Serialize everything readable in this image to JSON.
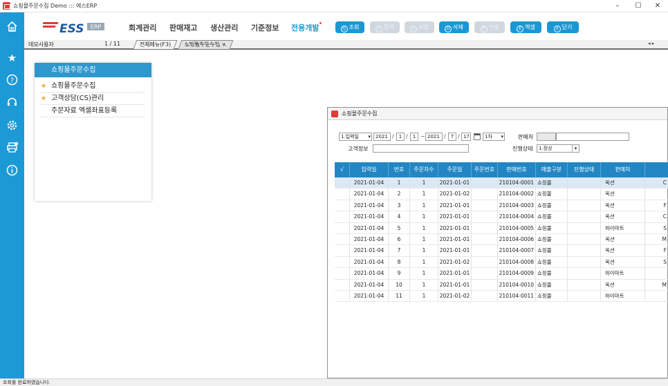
{
  "window": {
    "title": "쇼핑몰주문수집 Demo ::: 에스ERP",
    "minimize": "–",
    "maximize": "☐",
    "close": "✕"
  },
  "rail_icons": [
    "home-icon",
    "star-icon",
    "help-icon",
    "headset-icon",
    "gear-icon",
    "printer-icon",
    "info-icon"
  ],
  "brand": {
    "logo_text": "ESS",
    "logo_badge": "ERP",
    "accent": "#1c9ad6",
    "logo_red": "#e33b36",
    "logo_blue": "#1d5a9e"
  },
  "menu": [
    "회계관리",
    "판매재고",
    "생산관리",
    "기준정보",
    "전용개발"
  ],
  "toolbar": [
    {
      "key": "Q",
      "label": "조회",
      "enabled": true
    },
    {
      "key": "I",
      "label": "입력",
      "enabled": false
    },
    {
      "key": "S",
      "label": "저장",
      "enabled": false
    },
    {
      "key": "D",
      "label": "삭제",
      "enabled": true
    },
    {
      "key": "P",
      "label": "인쇄",
      "enabled": false
    },
    {
      "key": "E",
      "label": "엑셀",
      "enabled": true
    },
    {
      "key": "X",
      "label": "닫기",
      "enabled": true
    }
  ],
  "tabstrip": {
    "user": "데모사용자",
    "page_counter": "1 / 11",
    "tabs": [
      "전체메뉴(F3)",
      "쇼핑몰주문수집"
    ],
    "tab_close": "×",
    "nav": "◂ ▸"
  },
  "side_panel": {
    "title": "쇼핑몰주문수집",
    "items": [
      {
        "label": "쇼핑몰주문수집",
        "starred": true
      },
      {
        "label": "고객상담(CS)관리",
        "starred": true
      },
      {
        "label": "주문자료 엑셀좌표등록",
        "starred": false
      }
    ]
  },
  "inner_window": {
    "title": "쇼핑몰주문수집",
    "filters": {
      "date_type": "1.입력일",
      "from": {
        "year": "2021",
        "month": "1",
        "day": "1"
      },
      "range_sep": "~",
      "to": {
        "year": "2021",
        "month": "7",
        "day": "17"
      },
      "cycle": "1차",
      "seller_label": "판매처",
      "customer_label": "고객정보",
      "status_label": "진행상태",
      "status_value": "1.정상"
    },
    "columns": [
      "√",
      "입력일",
      "번호",
      "주문차수",
      "주문일",
      "주문번호",
      "판매번호",
      "매출구분",
      "진행상태",
      "판매처",
      ""
    ],
    "rows": [
      [
        "",
        "2021-01-04",
        "1",
        "1",
        "2021-01-01",
        "",
        "210104-0001",
        "쇼핑몰",
        "",
        "옥션",
        "C"
      ],
      [
        "",
        "2021-01-04",
        "2",
        "1",
        "2021-01-02",
        "",
        "210104-0002",
        "쇼핑몰",
        "",
        "옥션",
        ""
      ],
      [
        "",
        "2021-01-04",
        "3",
        "1",
        "2021-01-01",
        "",
        "210104-0003",
        "쇼핑몰",
        "",
        "옥션",
        "F"
      ],
      [
        "",
        "2021-01-04",
        "4",
        "1",
        "2021-01-01",
        "",
        "210104-0004",
        "쇼핑몰",
        "",
        "옥션",
        "C"
      ],
      [
        "",
        "2021-01-04",
        "5",
        "1",
        "2021-01-01",
        "",
        "210104-0005",
        "쇼핑몰",
        "",
        "하이마트",
        "S"
      ],
      [
        "",
        "2021-01-04",
        "6",
        "1",
        "2021-01-01",
        "",
        "210104-0006",
        "쇼핑몰",
        "",
        "옥션",
        "M"
      ],
      [
        "",
        "2021-01-04",
        "7",
        "1",
        "2021-01-01",
        "",
        "210104-0007",
        "쇼핑몰",
        "",
        "옥션",
        "F"
      ],
      [
        "",
        "2021-01-04",
        "8",
        "1",
        "2021-01-02",
        "",
        "210104-0008",
        "쇼핑몰",
        "",
        "옥션",
        "S"
      ],
      [
        "",
        "2021-01-04",
        "9",
        "1",
        "2021-01-01",
        "",
        "210104-0009",
        "쇼핑몰",
        "",
        "하이마트",
        ""
      ],
      [
        "",
        "2021-01-04",
        "10",
        "1",
        "2021-01-01",
        "",
        "210104-0010",
        "쇼핑몰",
        "",
        "옥션",
        "M"
      ],
      [
        "",
        "2021-01-04",
        "11",
        "1",
        "2021-01-02",
        "",
        "210104-0011",
        "쇼핑몰",
        "",
        "하이마트",
        ""
      ]
    ]
  },
  "status_bar": {
    "text": "조회를 완료하였습니다."
  }
}
